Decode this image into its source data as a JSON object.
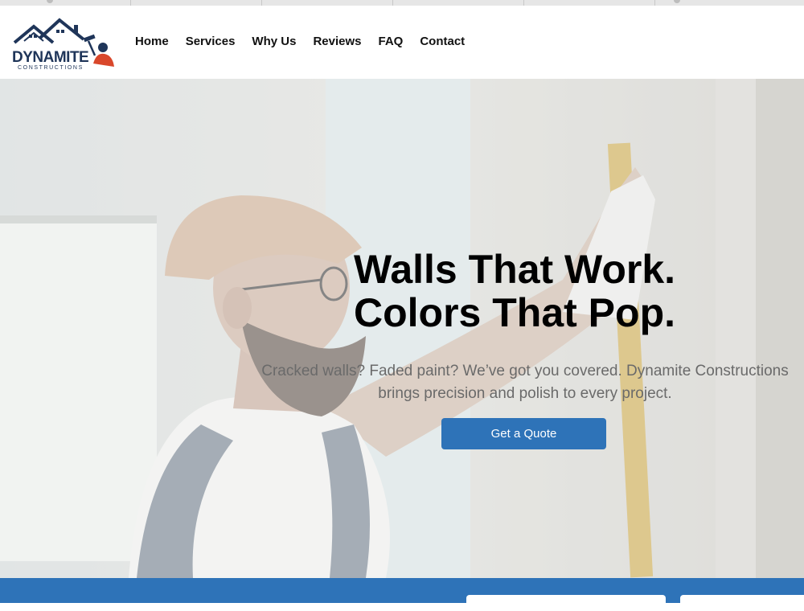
{
  "brand": {
    "name": "DYNAMITE",
    "tagline": "CONSTRUCTIONS",
    "colors": {
      "navy": "#1f3559",
      "accent_red": "#d9472b"
    }
  },
  "nav": {
    "items": [
      {
        "label": "Home"
      },
      {
        "label": "Services"
      },
      {
        "label": "Why Us"
      },
      {
        "label": "Reviews"
      },
      {
        "label": "FAQ"
      },
      {
        "label": "Contact"
      }
    ]
  },
  "hero": {
    "title_line1": "Walls That Work.",
    "title_line2": "Colors That Pop.",
    "subtitle_line1": "Cracked walls? Faded paint? We’ve got you covered. Dynamite Constructions",
    "subtitle_line2": "brings precision and polish to every project.",
    "cta_label": "Get a Quote",
    "cta_color": "#2e73b8"
  },
  "band": {
    "color": "#2e73b8"
  }
}
